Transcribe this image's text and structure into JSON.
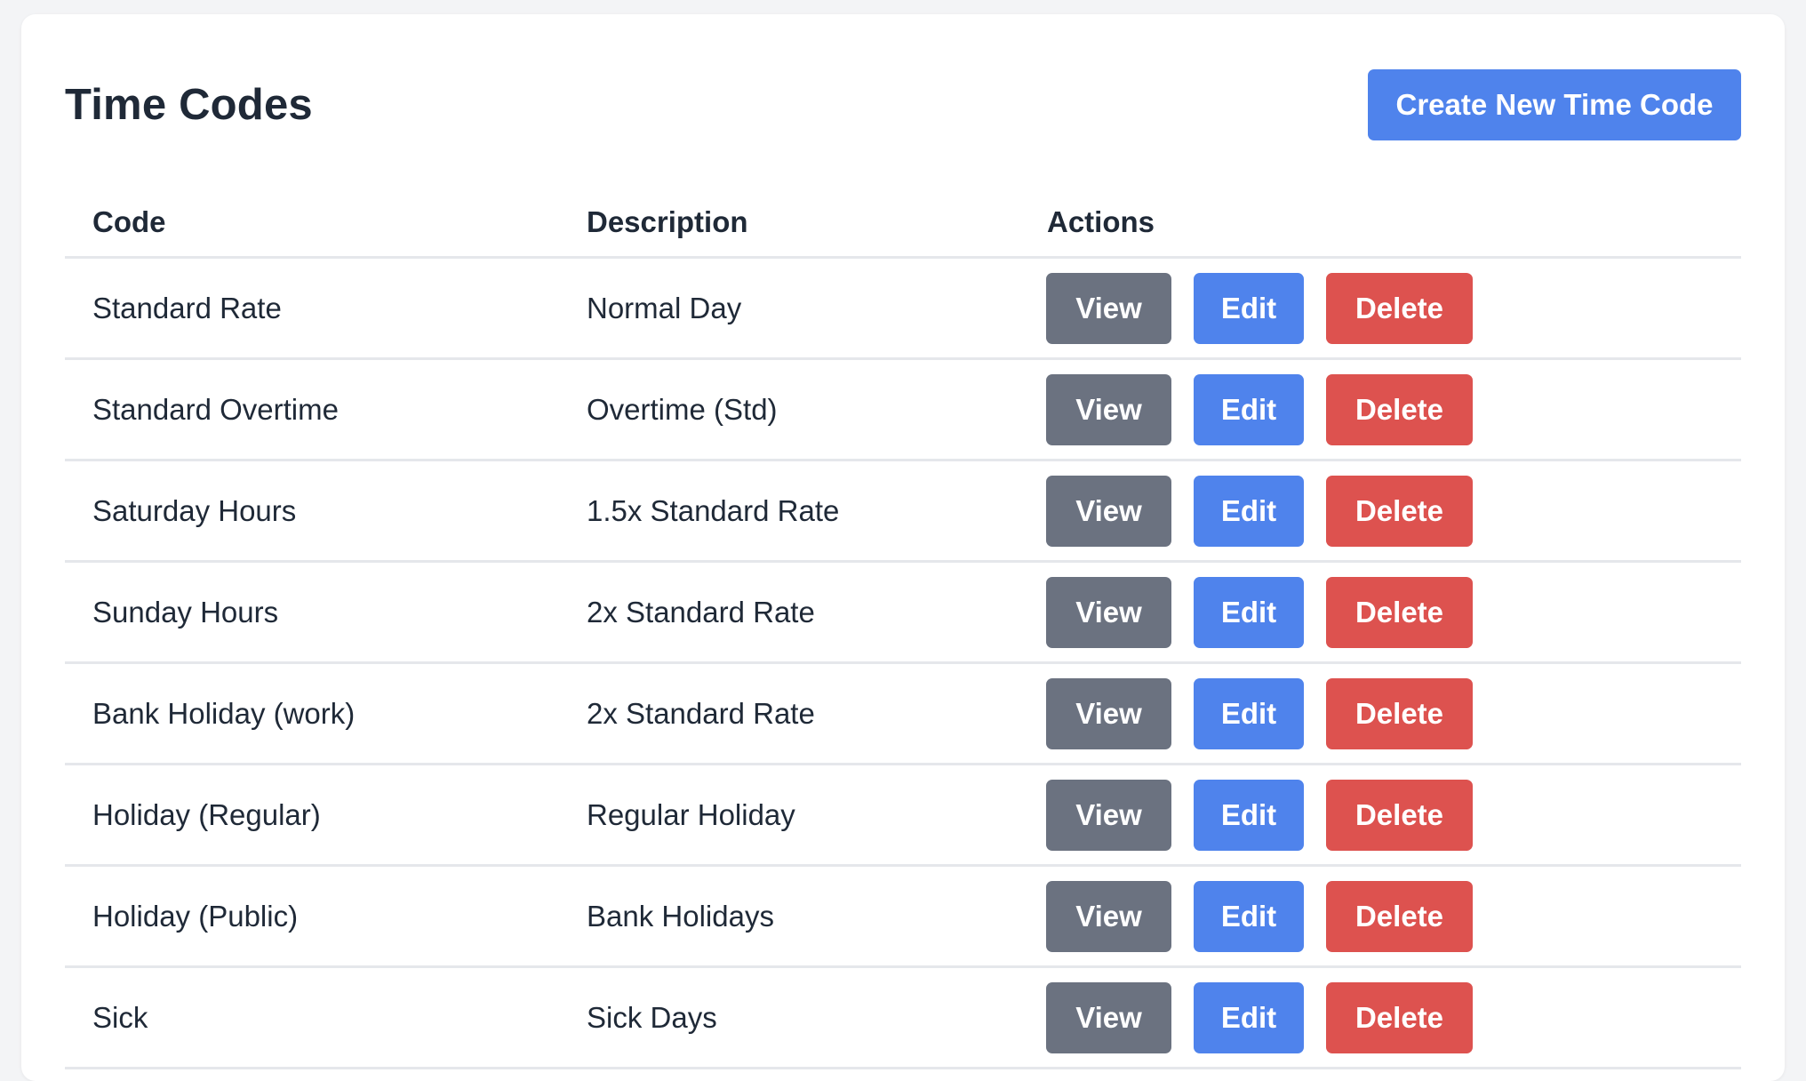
{
  "page": {
    "title": "Time Codes",
    "create_button_label": "Create New Time Code"
  },
  "colors": {
    "primary": "#4f83ec",
    "secondary": "#6b7280",
    "danger": "#dd524f",
    "background": "#f3f4f6",
    "text": "#1f2937"
  },
  "table": {
    "headers": [
      "Code",
      "Description",
      "Actions"
    ],
    "action_labels": {
      "view": "View",
      "edit": "Edit",
      "delete": "Delete"
    },
    "rows": [
      {
        "code": "Standard Rate",
        "description": "Normal Day"
      },
      {
        "code": "Standard Overtime",
        "description": "Overtime (Std)"
      },
      {
        "code": "Saturday Hours",
        "description": "1.5x Standard Rate"
      },
      {
        "code": "Sunday Hours",
        "description": "2x Standard Rate"
      },
      {
        "code": "Bank Holiday (work)",
        "description": "2x Standard Rate"
      },
      {
        "code": "Holiday (Regular)",
        "description": "Regular Holiday"
      },
      {
        "code": "Holiday (Public)",
        "description": "Bank Holidays"
      },
      {
        "code": "Sick",
        "description": "Sick Days"
      }
    ]
  }
}
